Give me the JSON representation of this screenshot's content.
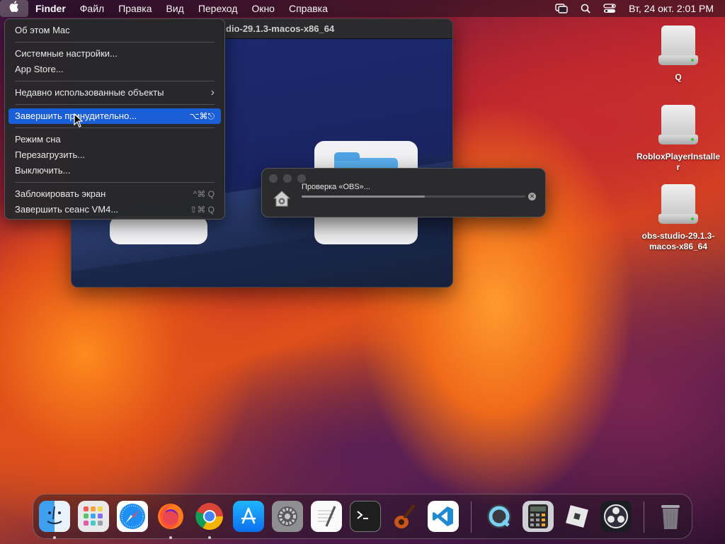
{
  "menubar": {
    "apple_icon": "apple-icon",
    "app_name": "Finder",
    "items": [
      "Файл",
      "Правка",
      "Вид",
      "Переход",
      "Окно",
      "Справка"
    ],
    "status_icons": [
      "screen-mirroring-icon",
      "spotlight-search-icon",
      "control-center-icon"
    ],
    "clock": "Вт, 24 окт.  2:01 PM"
  },
  "finder_window": {
    "title": "dio-29.1.3-macos-x86_64"
  },
  "apple_menu": {
    "items": [
      {
        "label": "Об этом Mac",
        "shortcut": ""
      },
      {
        "label": "Системные настройки...",
        "shortcut": ""
      },
      {
        "label": "App Store...",
        "shortcut": ""
      },
      {
        "label": "Недавно использованные объекты",
        "shortcut": ""
      },
      {
        "label": "Завершить принудительно...",
        "shortcut": "⌥⌘⎋"
      },
      {
        "label": "Режим сна",
        "shortcut": ""
      },
      {
        "label": "Перезагрузить...",
        "shortcut": ""
      },
      {
        "label": "Выключить...",
        "shortcut": ""
      },
      {
        "label": "Заблокировать экран",
        "shortcut": "^⌘ Q"
      },
      {
        "label": "Завершить сеанс VM4...",
        "shortcut": "⇧⌘ Q"
      }
    ],
    "highlight_color": "#1a5fd8"
  },
  "progress_dialog": {
    "message": "Проверка «OBS»...",
    "progress": 0.55,
    "icon": "house-icon",
    "cancel_icon": "close-circle-icon"
  },
  "desktop_icons": [
    {
      "label": "Q",
      "icon": "disk-image-icon"
    },
    {
      "label": "RobloxPlayerInstaller",
      "icon": "disk-image-icon"
    },
    {
      "label": "obs-studio-29.1.3-macos-x86_64",
      "icon": "disk-image-icon"
    }
  ],
  "dock": {
    "apps": [
      {
        "name": "Finder",
        "icon": "finder-icon",
        "running": true
      },
      {
        "name": "Launchpad",
        "icon": "launchpad-icon",
        "running": false
      },
      {
        "name": "Safari",
        "icon": "safari-icon",
        "running": false
      },
      {
        "name": "Firefox",
        "icon": "firefox-icon",
        "running": true
      },
      {
        "name": "Chrome",
        "icon": "chrome-icon",
        "running": true
      },
      {
        "name": "App Store",
        "icon": "app-store-icon",
        "running": false
      },
      {
        "name": "System Settings",
        "icon": "settings-icon",
        "running": false
      },
      {
        "name": "TextEdit",
        "icon": "textedit-icon",
        "running": false
      },
      {
        "name": "Terminal",
        "icon": "terminal-icon",
        "running": false
      },
      {
        "name": "GarageBand",
        "icon": "garageband-icon",
        "running": false
      },
      {
        "name": "VS Code",
        "icon": "vscode-icon",
        "running": false
      },
      {
        "name": "QuickTime",
        "icon": "quicktime-icon",
        "running": false
      },
      {
        "name": "Calculator",
        "icon": "calculator-icon",
        "running": false
      },
      {
        "name": "Roblox",
        "icon": "roblox-icon",
        "running": false
      },
      {
        "name": "OBS",
        "icon": "obs-icon",
        "running": false
      },
      {
        "name": "Trash",
        "icon": "trash-icon",
        "running": false
      }
    ]
  }
}
